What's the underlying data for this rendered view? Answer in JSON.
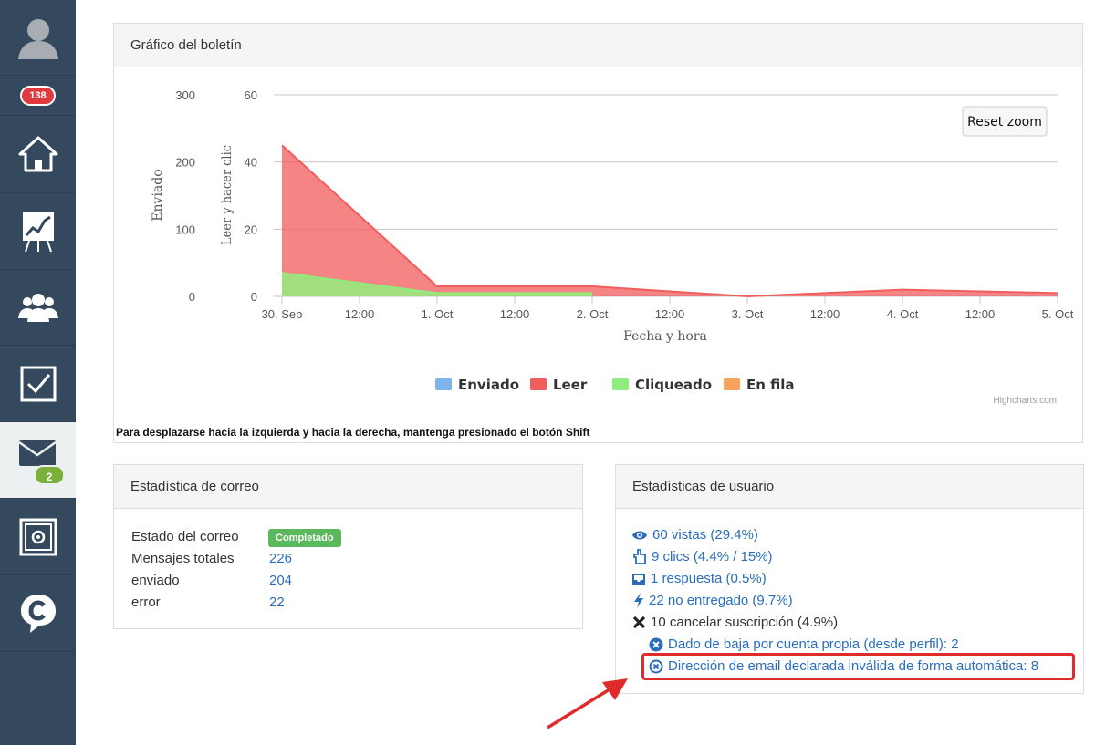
{
  "sidebar": {
    "notifications_badge": "138",
    "mail_badge": "2",
    "icons": [
      "avatar",
      "home-icon",
      "chart-icon",
      "users-icon",
      "checkbox-icon",
      "mail-icon",
      "safe-icon",
      "cleverreach-icon"
    ]
  },
  "chart_panel": {
    "title": "Gráfico del boletín",
    "reset_zoom": "Reset zoom",
    "credit": "Highcharts.com",
    "note": "Para desplazarse hacia la izquierda y hacia la derecha, mantenga presionado el botón Shift"
  },
  "chart_data": {
    "type": "area",
    "xlabel": "Fecha y hora",
    "ylabel_left": "Enviado",
    "ylabel_right": "Leer y hacer clic",
    "yticks_left": [
      "300",
      "200",
      "100",
      "0"
    ],
    "yticks_right": [
      "60",
      "40",
      "20",
      "0"
    ],
    "ylim_left": [
      0,
      300
    ],
    "ylim_right": [
      0,
      60
    ],
    "xticks": [
      "30. Sep",
      "12:00",
      "1. Oct",
      "12:00",
      "2. Oct",
      "12:00",
      "3. Oct",
      "12:00",
      "4. Oct",
      "12:00",
      "5. Oct"
    ],
    "legend": [
      {
        "name": "Enviado",
        "color": "#7cb5ec"
      },
      {
        "name": "Leer",
        "color": "#f15c5c"
      },
      {
        "name": "Cliqueado",
        "color": "#90ed7d"
      },
      {
        "name": "En fila",
        "color": "#f7a35c"
      }
    ],
    "series": [
      {
        "name": "Leer",
        "color": "#f15c5c",
        "x": [
          0,
          1,
          2,
          3,
          4,
          5
        ],
        "values": [
          45,
          3,
          3,
          0,
          2,
          1
        ]
      },
      {
        "name": "Cliqueado",
        "color": "#90ed7d",
        "x": [
          0,
          1,
          2
        ],
        "values": [
          7,
          1,
          1
        ]
      }
    ]
  },
  "mail_stats": {
    "title": "Estadística de correo",
    "rows": [
      {
        "label": "Estado del correo",
        "value": "Completado"
      },
      {
        "label": "Mensajes totales",
        "value": "226"
      },
      {
        "label": "enviado",
        "value": "204"
      },
      {
        "label": "error",
        "value": "22"
      }
    ]
  },
  "user_stats": {
    "title": "Estadísticas de usuario",
    "views": "60 vistas (29.4%)",
    "clicks": "9 clics (4.4% / 15%)",
    "responses": "1 respuesta (0.5%)",
    "undelivered": "22 no entregado (9.7%)",
    "unsubscribed": "10 cancelar suscripción (4.9%)",
    "unsub_own": "Dado de baja por cuenta propia (desde perfil): 2",
    "unsub_invalid": "Dirección de email declarada inválida de forma automática: 8"
  }
}
